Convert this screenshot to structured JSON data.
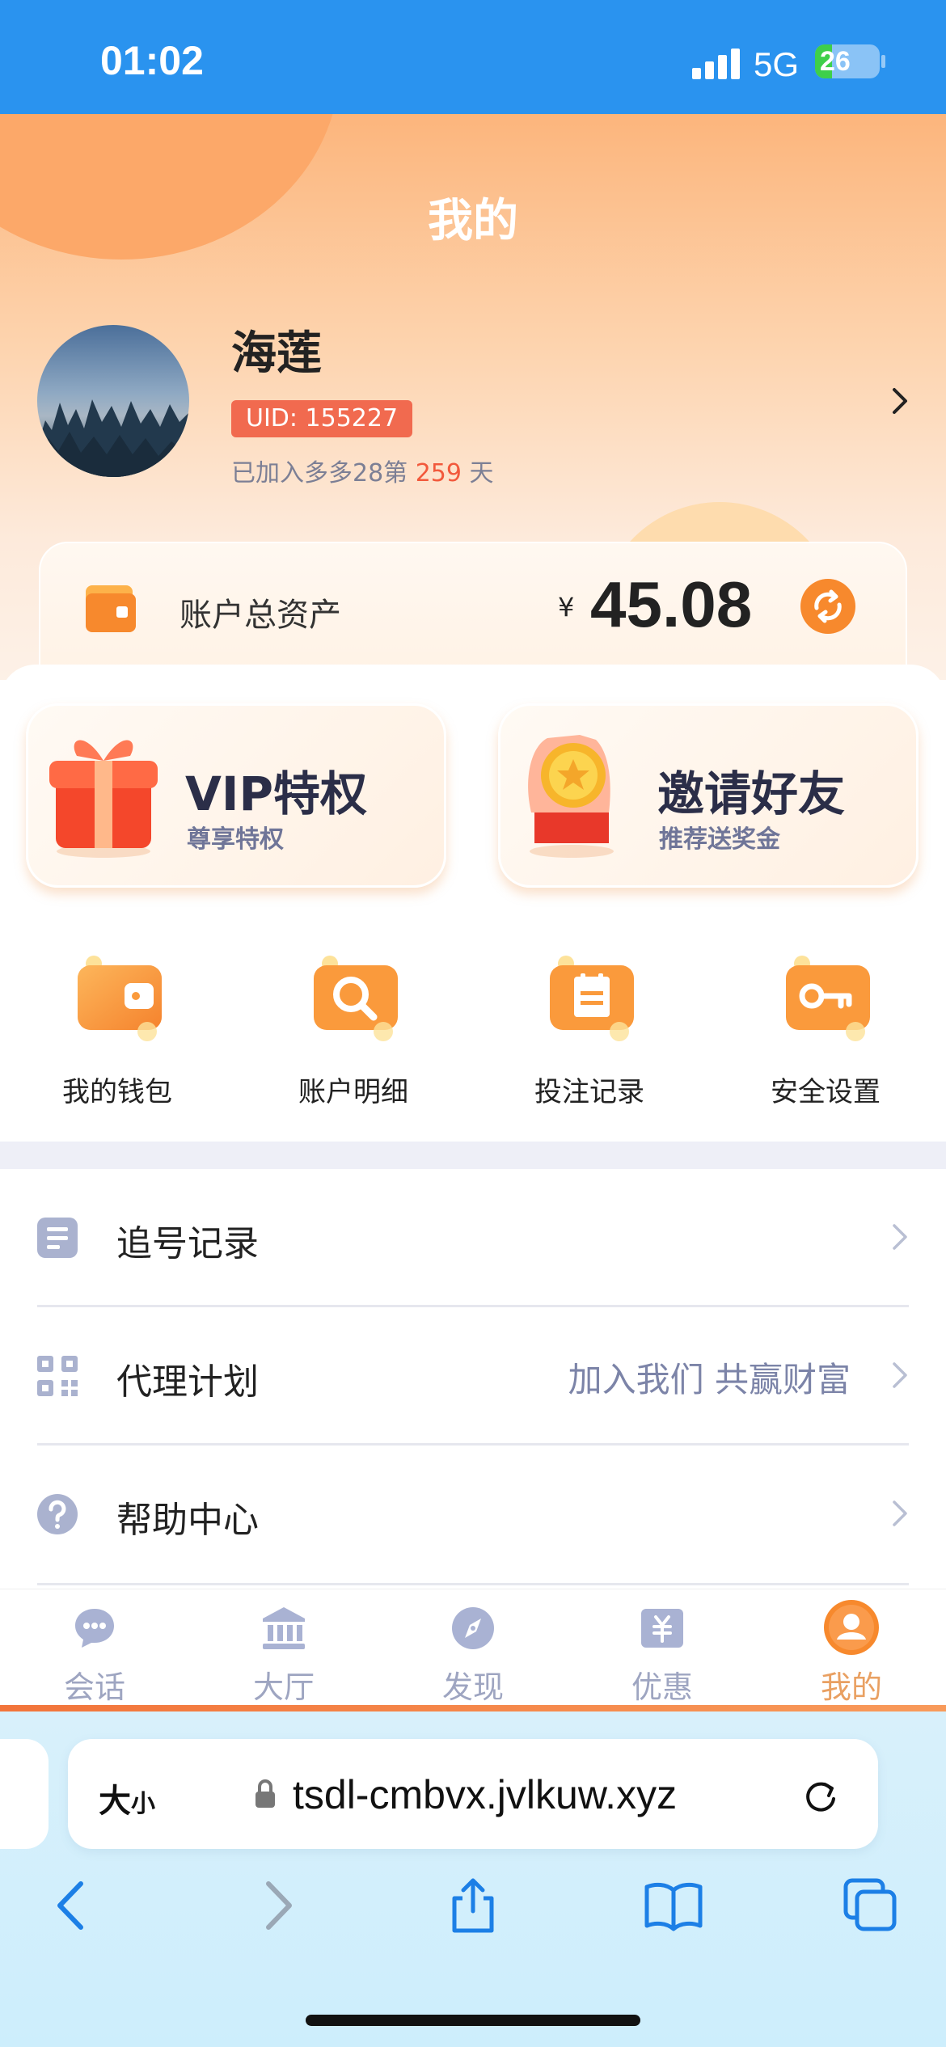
{
  "status_bar": {
    "time": "01:02",
    "network": "5G",
    "battery": "26",
    "battery_level": 0.26
  },
  "header": {
    "title": "我的"
  },
  "profile": {
    "name": "海莲",
    "uid": "UID: 155227",
    "joined_prefix": "已加入多多28第 ",
    "joined_days": "259",
    "joined_suffix": " 天"
  },
  "assets": {
    "label": "账户总资产",
    "currency": "¥",
    "amount": "45.08"
  },
  "promos": [
    {
      "title": "VIP特权",
      "subtitle": "尊享特权"
    },
    {
      "title": "邀请好友",
      "subtitle": "推荐送奖金"
    }
  ],
  "quick_actions": [
    {
      "label": "我的钱包",
      "icon": "wallet-icon"
    },
    {
      "label": "账户明细",
      "icon": "search-icon"
    },
    {
      "label": "投注记录",
      "icon": "notepad-icon"
    },
    {
      "label": "安全设置",
      "icon": "key-icon"
    }
  ],
  "menu": [
    {
      "label": "追号记录",
      "extra": "",
      "icon": "document-icon"
    },
    {
      "label": "代理计划",
      "extra": "加入我们 共赢财富",
      "icon": "qr-code-icon"
    },
    {
      "label": "帮助中心",
      "extra": "",
      "icon": "help-icon"
    }
  ],
  "bottom_nav": [
    {
      "label": "会话",
      "icon": "chat-icon"
    },
    {
      "label": "大厅",
      "icon": "bank-icon"
    },
    {
      "label": "发现",
      "icon": "compass-icon"
    },
    {
      "label": "优惠",
      "icon": "coupon-icon"
    },
    {
      "label": "我的",
      "icon": "user-icon",
      "active": true
    }
  ],
  "browser": {
    "text_size": "大",
    "text_size_small": "小",
    "url": "tsdl-cmbvx.jvlkuw.xyz"
  },
  "colors": {
    "accent": "#f7892d",
    "status_bar": "#2a93ef",
    "active_nav": "#e9a062"
  }
}
